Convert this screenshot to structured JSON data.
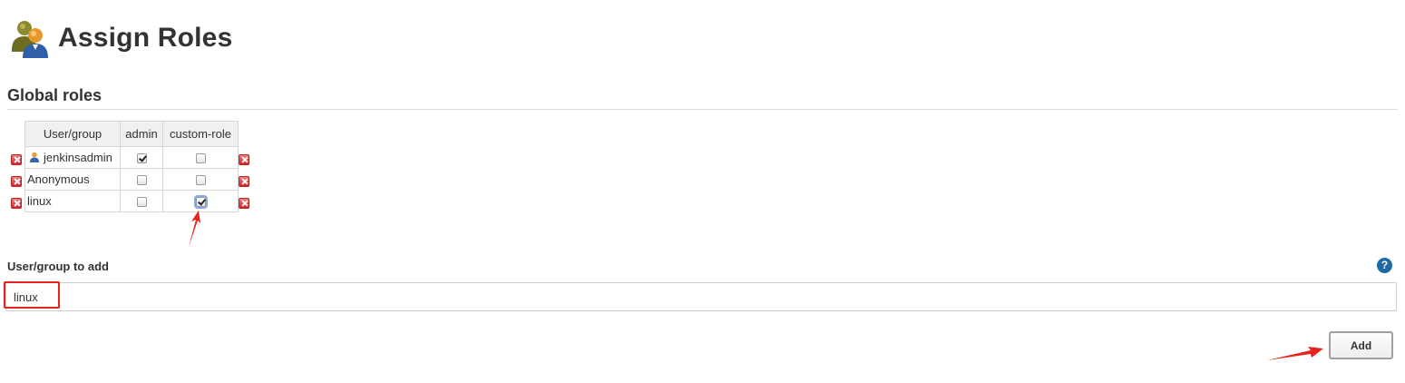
{
  "header": {
    "title": "Assign Roles",
    "icon": "user-group-icon"
  },
  "global_roles": {
    "title": "Global roles",
    "columns": [
      "User/group",
      "admin",
      "custom-role"
    ],
    "rows": [
      {
        "name": "jenkinsadmin",
        "user_icon": true,
        "admin": true,
        "custom_role": false
      },
      {
        "name": "Anonymous",
        "user_icon": false,
        "admin": false,
        "custom_role": false
      },
      {
        "name": "linux",
        "user_icon": false,
        "admin": false,
        "custom_role": true
      }
    ]
  },
  "add_section": {
    "label": "User/group to add",
    "input_value": "linux",
    "help": "?",
    "button_label": "Add"
  },
  "colors": {
    "annotation": "#e8211c",
    "help_icon": "#1d6aa5",
    "delete_icon": "#c72b2b"
  }
}
